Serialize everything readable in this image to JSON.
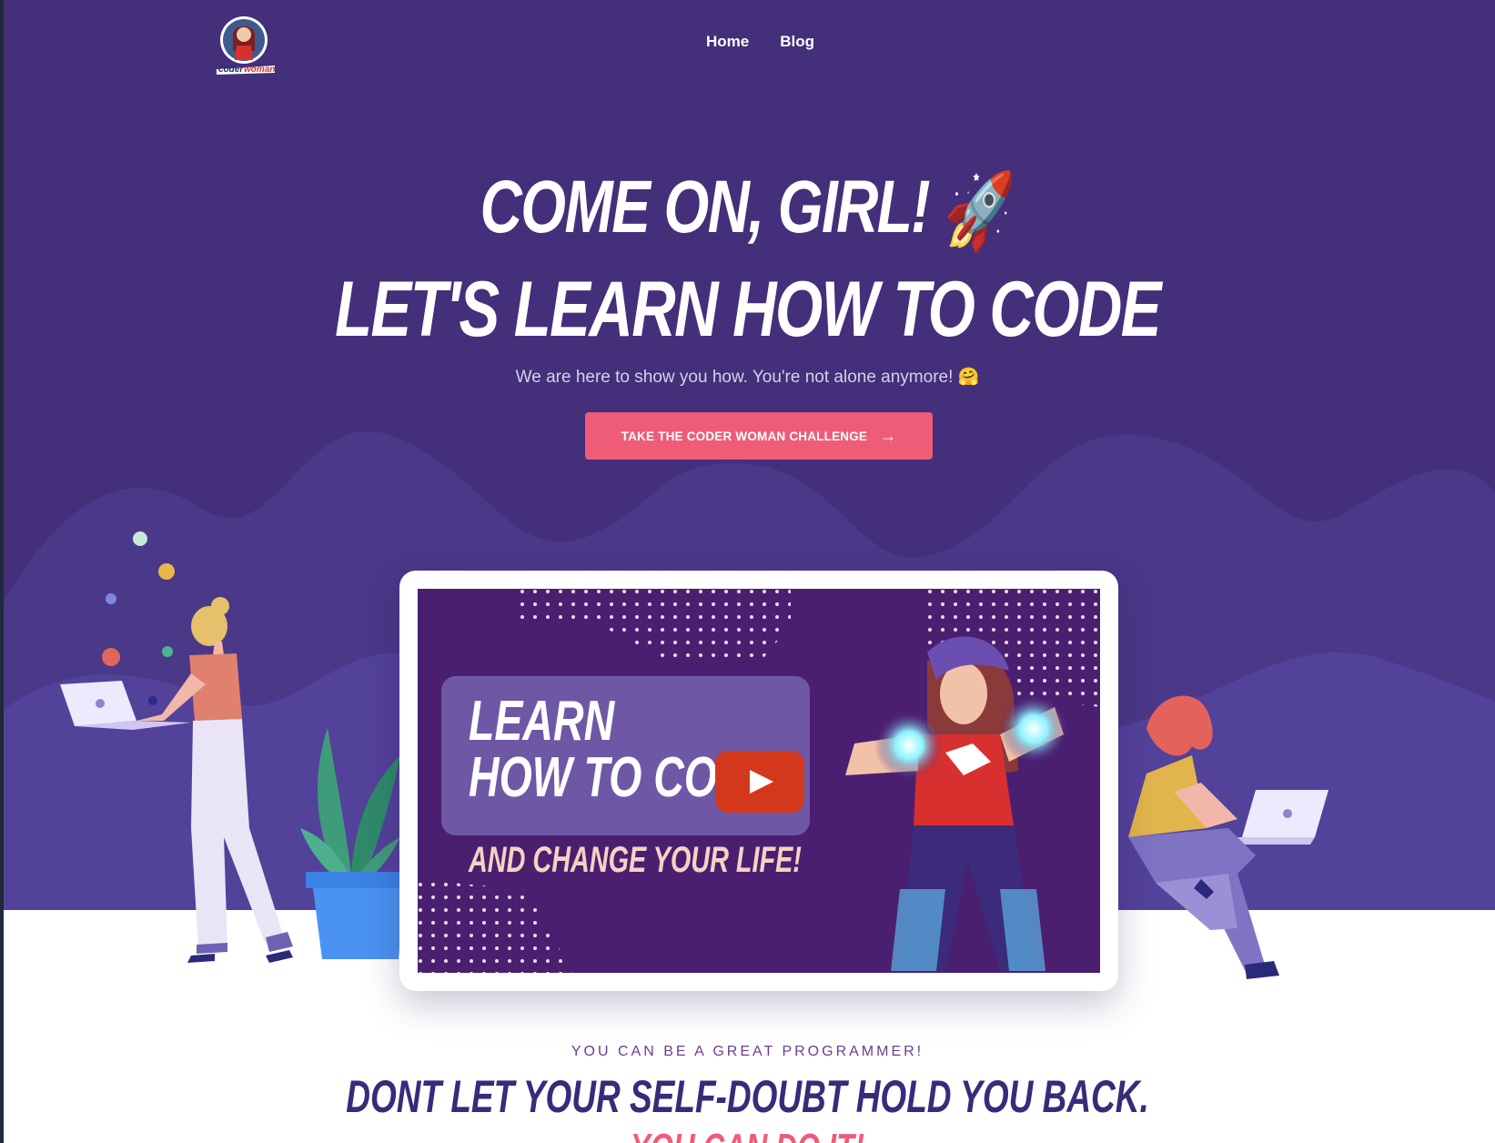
{
  "header": {
    "logo_text": "coderwoman",
    "nav": [
      {
        "label": "Home"
      },
      {
        "label": "Blog"
      }
    ]
  },
  "hero": {
    "title_line1": "Come on, girl!",
    "title_line1_emoji": "🚀",
    "title_line2": "Let's learn how to code",
    "subtitle": "We are here to show you how. You're not alone anymore! 🤗",
    "cta_label": "TAKE THE CODER WOMAN CHALLENGE",
    "cta_icon": "arrow-right-icon",
    "cta_color": "#ef5c78"
  },
  "video": {
    "line1": "Learn",
    "line2": "How to co",
    "line3": "And change your life!",
    "play_icon": "youtube-play-icon"
  },
  "section": {
    "eyebrow": "YOU CAN BE A GREAT PROGRAMMER!",
    "title": "Dont let your self-doubt hold you back.",
    "subtitle": "You can do it!"
  },
  "colors": {
    "hero_bg": "#432f7a",
    "accent": "#ef5c78",
    "heading_dark": "#3a2a7a"
  }
}
